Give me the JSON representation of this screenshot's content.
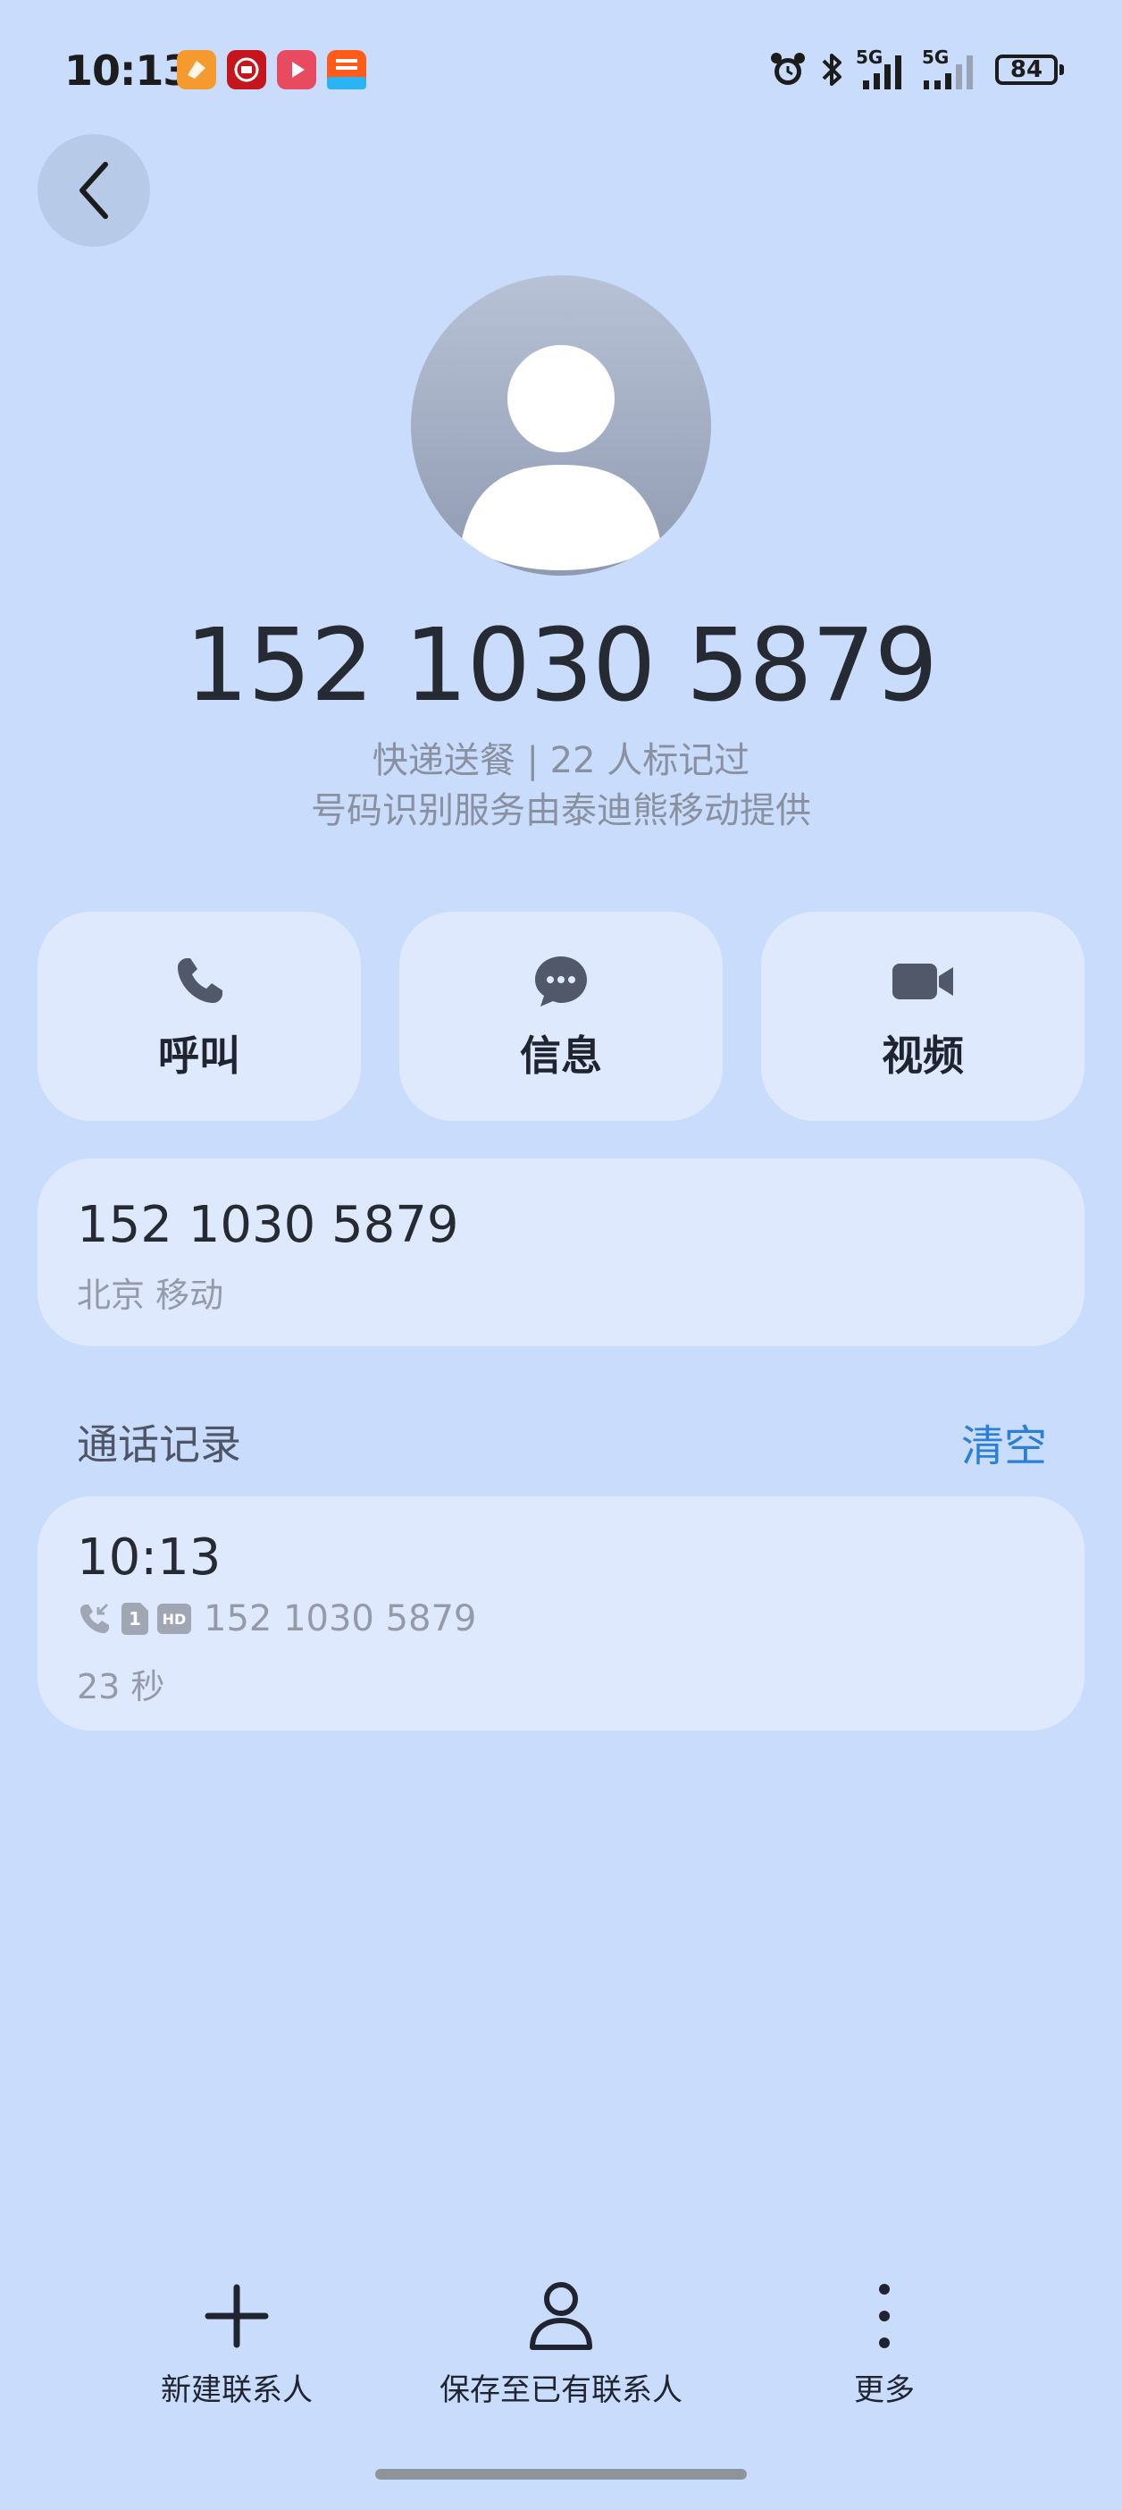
{
  "status_bar": {
    "time": "10:13",
    "battery": "84",
    "signal_label_1": "5G",
    "signal_label_2": "5G",
    "app_icons": [
      "orange-app-icon",
      "red-app-icon",
      "video-app-icon",
      "taobao-flash-app-icon"
    ]
  },
  "contact": {
    "phone_display": "152 1030 5879",
    "tag_line": "快递送餐 | 22 人标记过",
    "provider_line": "号码识别服务由泰迪熊移动提供"
  },
  "actions": [
    {
      "label": "呼叫",
      "icon": "phone-icon"
    },
    {
      "label": "信息",
      "icon": "message-icon"
    },
    {
      "label": "视频",
      "icon": "video-icon"
    }
  ],
  "number_card": {
    "number": "152 1030 5879",
    "location": "北京 移动"
  },
  "call_records": {
    "title": "通话记录",
    "clear_label": "清空",
    "items": [
      {
        "time": "10:13",
        "sim": "1",
        "hd": "HD",
        "number": "152 1030 5879",
        "duration": "23 秒"
      }
    ]
  },
  "bottom_bar": {
    "new_contact": "新建联系人",
    "save_existing": "保存至已有联系人",
    "more": "更多"
  },
  "colors": {
    "background": "#c9dcfb",
    "card": "#dee9fd",
    "accent": "#2a7fd6"
  }
}
